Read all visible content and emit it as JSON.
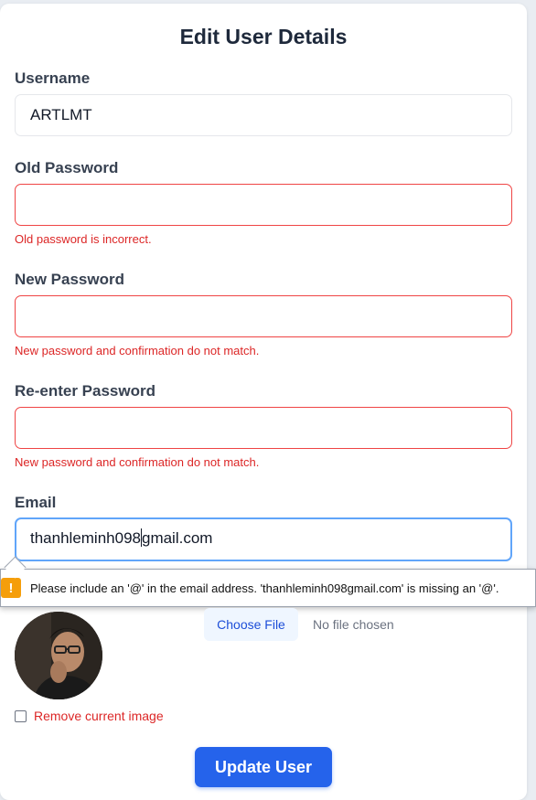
{
  "form": {
    "title": "Edit User Details",
    "username": {
      "label": "Username",
      "value": "ARTLMT"
    },
    "old_password": {
      "label": "Old Password",
      "value": "",
      "error": "Old password is incorrect."
    },
    "new_password": {
      "label": "New Password",
      "value": "",
      "error": "New password and confirmation do not match."
    },
    "reenter_password": {
      "label": "Re-enter Password",
      "value": "",
      "error": "New password and confirmation do not match."
    },
    "email": {
      "label": "Email",
      "value_before_caret": "thanhleminh098",
      "value_after_caret": "gmail.com"
    },
    "validation_tooltip": {
      "icon": "!",
      "message": "Please include an '@' in the email address. 'thanhleminh098gmail.com' is missing an '@'."
    },
    "image": {
      "choose_file_label": "Choose File",
      "file_status": "No file chosen",
      "remove_label": "Remove current image",
      "remove_checked": false
    },
    "submit_label": "Update User"
  },
  "colors": {
    "primary": "#2563eb",
    "error": "#dc2626",
    "warning": "#f59e0b"
  }
}
